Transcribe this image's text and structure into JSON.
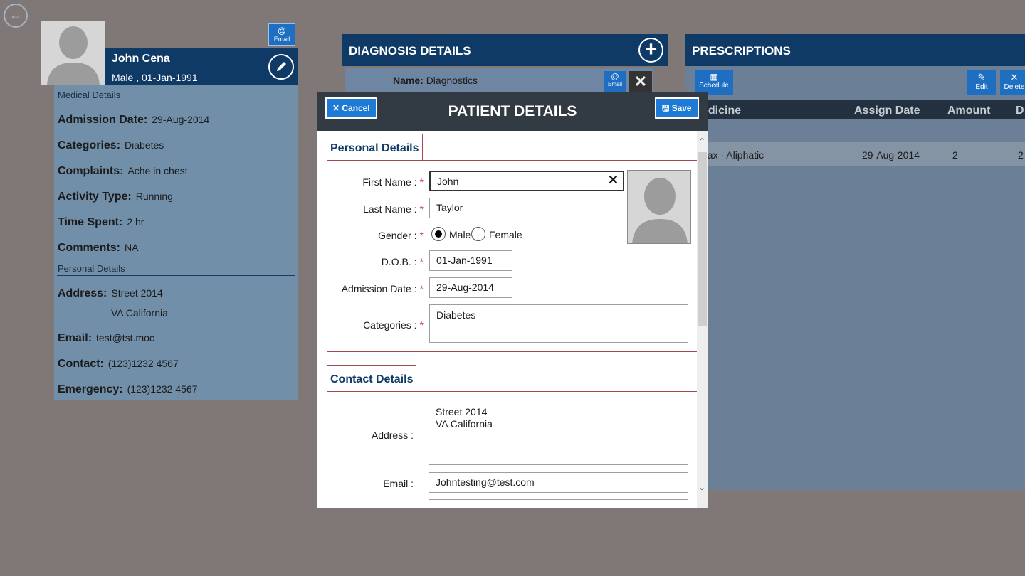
{
  "patient": {
    "name": "John Cena",
    "info": "Male ,  01-Jan-1991",
    "email_label": "Email",
    "medical_title": "Medical Details",
    "personal_title": "Personal Details",
    "fields": {
      "admission_label": "Admission Date:",
      "admission_value": "29-Aug-2014",
      "categories_label": "Categories:",
      "categories_value": "Diabetes",
      "complaints_label": "Complaints:",
      "complaints_value": "Ache in chest",
      "activity_label": "Activity Type:",
      "activity_value": "Running",
      "time_label": "Time Spent:",
      "time_value": "2 hr",
      "comments_label": "Comments:",
      "comments_value": "NA",
      "address_label": "Address:",
      "address_line1": "Street 2014",
      "address_line2": "VA California",
      "email_label": "Email:",
      "email_value": "test@tst.moc",
      "contact_label": "Contact:",
      "contact_value": "(123)1232 4567",
      "emergency_label": "Emergency:",
      "emergency_value": "(123)1232 4567"
    }
  },
  "diagnosis": {
    "title": "DIAGNOSIS DETAILS",
    "name_label": "Name:",
    "name_value": "Diagnostics",
    "email_label": "Email"
  },
  "prescriptions": {
    "title": "PRESCRIPTIONS",
    "schedule_label": "Schedule",
    "edit_label": "Edit",
    "delete_label": "Delete",
    "columns": [
      "edicine",
      "Assign Date",
      "Amount",
      "D"
    ],
    "rows": [
      {
        "medicine": "nax - Aliphatic",
        "date": "29-Aug-2014",
        "amount": "2",
        "d": "2"
      }
    ]
  },
  "modal": {
    "title": "PATIENT DETAILS",
    "cancel_label": "Cancel",
    "save_label": "Save",
    "personal_group": "Personal Details",
    "contact_group": "Contact Details",
    "first_name_label": "First Name :",
    "first_name_value": "John",
    "last_name_label": "Last Name :",
    "last_name_value": "Taylor",
    "gender_label": "Gender :",
    "gender_male": "Male",
    "gender_female": "Female",
    "dob_label": "D.O.B. :",
    "dob_value": "01-Jan-1991",
    "admission_label": "Admission Date :",
    "admission_value": "29-Aug-2014",
    "categories_label": "Categories :",
    "categories_value": "Diabetes",
    "address_label": "Address :",
    "address_line1": "Street 2014",
    "address_line2": "VA California",
    "email_label": "Email :",
    "email_value": "Johntesting@test.com",
    "required_mark": "*"
  },
  "colors": {
    "navy": "#0f3a66",
    "accent_blue": "#1e7ad4",
    "modal_header": "#323a43",
    "required": "#d64545"
  }
}
